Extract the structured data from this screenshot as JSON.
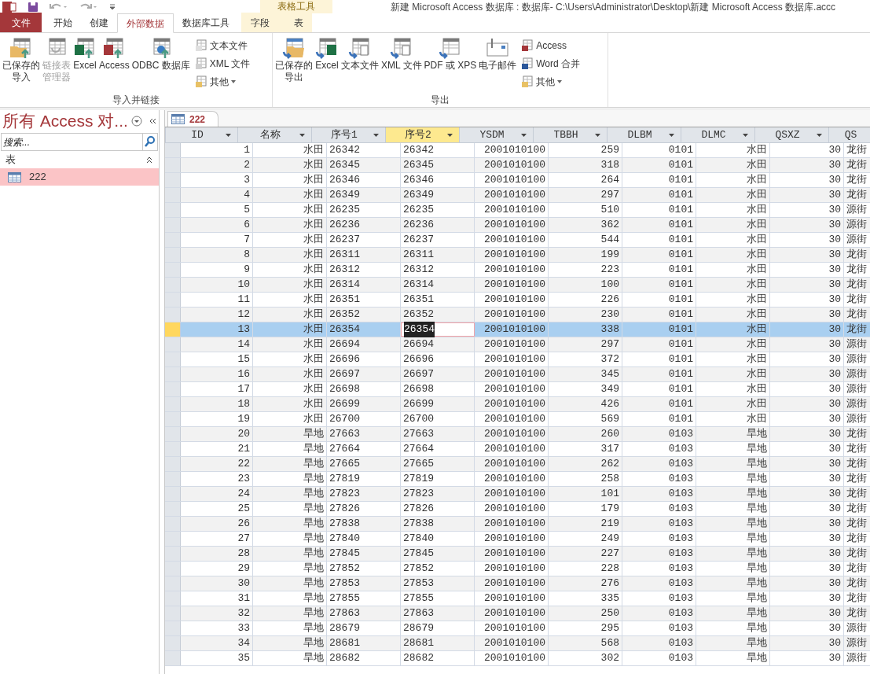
{
  "title_bar": {
    "context_label": "表格工具",
    "title": "新建 Microsoft Access 数据库 : 数据库- C:\\Users\\Administrator\\Desktop\\新建 Microsoft Access 数据库.accc"
  },
  "tabs": [
    {
      "label": "文件",
      "kind": "file",
      "selected": false
    },
    {
      "label": "开始",
      "kind": "normal",
      "selected": false
    },
    {
      "label": "创建",
      "kind": "normal",
      "selected": false
    },
    {
      "label": "外部数据",
      "kind": "normal",
      "selected": true
    },
    {
      "label": "数据库工具",
      "kind": "normal",
      "selected": false
    },
    {
      "label": "字段",
      "kind": "contextual",
      "selected": false
    },
    {
      "label": "表",
      "kind": "contextual",
      "selected": false
    }
  ],
  "ribbon_groups": [
    {
      "label": "导入并链接",
      "large_buttons": [
        {
          "lines": [
            "已保存的",
            "导入"
          ],
          "disabled": false
        },
        {
          "lines": [
            "链接表",
            "管理器"
          ],
          "disabled": true
        },
        {
          "lines": [
            "Excel"
          ],
          "disabled": false
        },
        {
          "lines": [
            "Access"
          ],
          "disabled": false
        },
        {
          "lines": [
            "ODBC 数据库"
          ],
          "disabled": false
        }
      ],
      "small_buttons": [
        {
          "label": "文本文件",
          "dropdown": false
        },
        {
          "label": "XML 文件",
          "dropdown": false
        },
        {
          "label": "其他",
          "dropdown": true
        }
      ]
    },
    {
      "label": "导出",
      "large_buttons": [
        {
          "lines": [
            "已保存的",
            "导出"
          ],
          "disabled": false
        },
        {
          "lines": [
            "Excel"
          ],
          "disabled": false
        },
        {
          "lines": [
            "文本文件"
          ],
          "disabled": false
        },
        {
          "lines": [
            "XML 文件"
          ],
          "disabled": false
        },
        {
          "lines": [
            "PDF 或 XPS"
          ],
          "disabled": false
        },
        {
          "lines": [
            "电子邮件"
          ],
          "disabled": false
        }
      ],
      "small_buttons": [
        {
          "label": "Access",
          "dropdown": false
        },
        {
          "label": "Word 合并",
          "dropdown": false
        },
        {
          "label": "其他",
          "dropdown": true
        }
      ]
    }
  ],
  "nav_pane": {
    "title": "所有 Access 对...",
    "search_placeholder": "搜索...",
    "section": "表",
    "items": [
      {
        "label": "222",
        "selected": true
      }
    ]
  },
  "document_tab": "222",
  "table": {
    "columns": [
      {
        "label": "ID",
        "selected": false
      },
      {
        "label": "名称",
        "selected": false
      },
      {
        "label": "序号1",
        "selected": false
      },
      {
        "label": "序号2",
        "selected": true
      },
      {
        "label": "YSDM",
        "selected": false
      },
      {
        "label": "TBBH",
        "selected": false
      },
      {
        "label": "DLBM",
        "selected": false
      },
      {
        "label": "DLMC",
        "selected": false
      },
      {
        "label": "QSXZ",
        "selected": false
      },
      {
        "label": "QS",
        "selected": false
      }
    ],
    "rows": [
      {
        "selected": false,
        "cells": [
          "1",
          "水田",
          "26342",
          "26342",
          "2001010100",
          "259",
          "0101",
          "水田",
          "30",
          "龙街"
        ]
      },
      {
        "selected": false,
        "cells": [
          "2",
          "水田",
          "26345",
          "26345",
          "2001010100",
          "318",
          "0101",
          "水田",
          "30",
          "龙街"
        ]
      },
      {
        "selected": false,
        "cells": [
          "3",
          "水田",
          "26346",
          "26346",
          "2001010100",
          "264",
          "0101",
          "水田",
          "30",
          "龙街"
        ]
      },
      {
        "selected": false,
        "cells": [
          "4",
          "水田",
          "26349",
          "26349",
          "2001010100",
          "297",
          "0101",
          "水田",
          "30",
          "龙街"
        ]
      },
      {
        "selected": false,
        "cells": [
          "5",
          "水田",
          "26235",
          "26235",
          "2001010100",
          "510",
          "0101",
          "水田",
          "30",
          "源街"
        ]
      },
      {
        "selected": false,
        "cells": [
          "6",
          "水田",
          "26236",
          "26236",
          "2001010100",
          "362",
          "0101",
          "水田",
          "30",
          "源街"
        ]
      },
      {
        "selected": false,
        "cells": [
          "7",
          "水田",
          "26237",
          "26237",
          "2001010100",
          "544",
          "0101",
          "水田",
          "30",
          "源街"
        ]
      },
      {
        "selected": false,
        "cells": [
          "8",
          "水田",
          "26311",
          "26311",
          "2001010100",
          "199",
          "0101",
          "水田",
          "30",
          "龙街"
        ]
      },
      {
        "selected": false,
        "cells": [
          "9",
          "水田",
          "26312",
          "26312",
          "2001010100",
          "223",
          "0101",
          "水田",
          "30",
          "龙街"
        ]
      },
      {
        "selected": false,
        "cells": [
          "10",
          "水田",
          "26314",
          "26314",
          "2001010100",
          "100",
          "0101",
          "水田",
          "30",
          "龙街"
        ]
      },
      {
        "selected": false,
        "cells": [
          "11",
          "水田",
          "26351",
          "26351",
          "2001010100",
          "226",
          "0101",
          "水田",
          "30",
          "龙街"
        ]
      },
      {
        "selected": false,
        "cells": [
          "12",
          "水田",
          "26352",
          "26352",
          "2001010100",
          "230",
          "0101",
          "水田",
          "30",
          "龙街"
        ]
      },
      {
        "selected": true,
        "cells": [
          "13",
          "水田",
          "26354",
          "26354",
          "2001010100",
          "338",
          "0101",
          "水田",
          "30",
          "龙街"
        ]
      },
      {
        "selected": false,
        "cells": [
          "14",
          "水田",
          "26694",
          "26694",
          "2001010100",
          "297",
          "0101",
          "水田",
          "30",
          "源街"
        ]
      },
      {
        "selected": false,
        "cells": [
          "15",
          "水田",
          "26696",
          "26696",
          "2001010100",
          "372",
          "0101",
          "水田",
          "30",
          "源街"
        ]
      },
      {
        "selected": false,
        "cells": [
          "16",
          "水田",
          "26697",
          "26697",
          "2001010100",
          "345",
          "0101",
          "水田",
          "30",
          "源街"
        ]
      },
      {
        "selected": false,
        "cells": [
          "17",
          "水田",
          "26698",
          "26698",
          "2001010100",
          "349",
          "0101",
          "水田",
          "30",
          "源街"
        ]
      },
      {
        "selected": false,
        "cells": [
          "18",
          "水田",
          "26699",
          "26699",
          "2001010100",
          "426",
          "0101",
          "水田",
          "30",
          "源街"
        ]
      },
      {
        "selected": false,
        "cells": [
          "19",
          "水田",
          "26700",
          "26700",
          "2001010100",
          "569",
          "0101",
          "水田",
          "30",
          "源街"
        ]
      },
      {
        "selected": false,
        "cells": [
          "20",
          "旱地",
          "27663",
          "27663",
          "2001010100",
          "260",
          "0103",
          "旱地",
          "30",
          "龙街"
        ]
      },
      {
        "selected": false,
        "cells": [
          "21",
          "旱地",
          "27664",
          "27664",
          "2001010100",
          "317",
          "0103",
          "旱地",
          "30",
          "龙街"
        ]
      },
      {
        "selected": false,
        "cells": [
          "22",
          "旱地",
          "27665",
          "27665",
          "2001010100",
          "262",
          "0103",
          "旱地",
          "30",
          "龙街"
        ]
      },
      {
        "selected": false,
        "cells": [
          "23",
          "旱地",
          "27819",
          "27819",
          "2001010100",
          "258",
          "0103",
          "旱地",
          "30",
          "龙街"
        ]
      },
      {
        "selected": false,
        "cells": [
          "24",
          "旱地",
          "27823",
          "27823",
          "2001010100",
          "101",
          "0103",
          "旱地",
          "30",
          "龙街"
        ]
      },
      {
        "selected": false,
        "cells": [
          "25",
          "旱地",
          "27826",
          "27826",
          "2001010100",
          "179",
          "0103",
          "旱地",
          "30",
          "龙街"
        ]
      },
      {
        "selected": false,
        "cells": [
          "26",
          "旱地",
          "27838",
          "27838",
          "2001010100",
          "219",
          "0103",
          "旱地",
          "30",
          "龙街"
        ]
      },
      {
        "selected": false,
        "cells": [
          "27",
          "旱地",
          "27840",
          "27840",
          "2001010100",
          "249",
          "0103",
          "旱地",
          "30",
          "龙街"
        ]
      },
      {
        "selected": false,
        "cells": [
          "28",
          "旱地",
          "27845",
          "27845",
          "2001010100",
          "227",
          "0103",
          "旱地",
          "30",
          "龙街"
        ]
      },
      {
        "selected": false,
        "cells": [
          "29",
          "旱地",
          "27852",
          "27852",
          "2001010100",
          "228",
          "0103",
          "旱地",
          "30",
          "龙街"
        ]
      },
      {
        "selected": false,
        "cells": [
          "30",
          "旱地",
          "27853",
          "27853",
          "2001010100",
          "276",
          "0103",
          "旱地",
          "30",
          "龙街"
        ]
      },
      {
        "selected": false,
        "cells": [
          "31",
          "旱地",
          "27855",
          "27855",
          "2001010100",
          "335",
          "0103",
          "旱地",
          "30",
          "龙街"
        ]
      },
      {
        "selected": false,
        "cells": [
          "32",
          "旱地",
          "27863",
          "27863",
          "2001010100",
          "250",
          "0103",
          "旱地",
          "30",
          "龙街"
        ]
      },
      {
        "selected": false,
        "cells": [
          "33",
          "旱地",
          "28679",
          "28679",
          "2001010100",
          "295",
          "0103",
          "旱地",
          "30",
          "源街"
        ]
      },
      {
        "selected": false,
        "cells": [
          "34",
          "旱地",
          "28681",
          "28681",
          "2001010100",
          "568",
          "0103",
          "旱地",
          "30",
          "源街"
        ]
      },
      {
        "selected": false,
        "cells": [
          "35",
          "旱地",
          "28682",
          "28682",
          "2001010100",
          "302",
          "0103",
          "旱地",
          "30",
          "源街"
        ]
      }
    ]
  }
}
